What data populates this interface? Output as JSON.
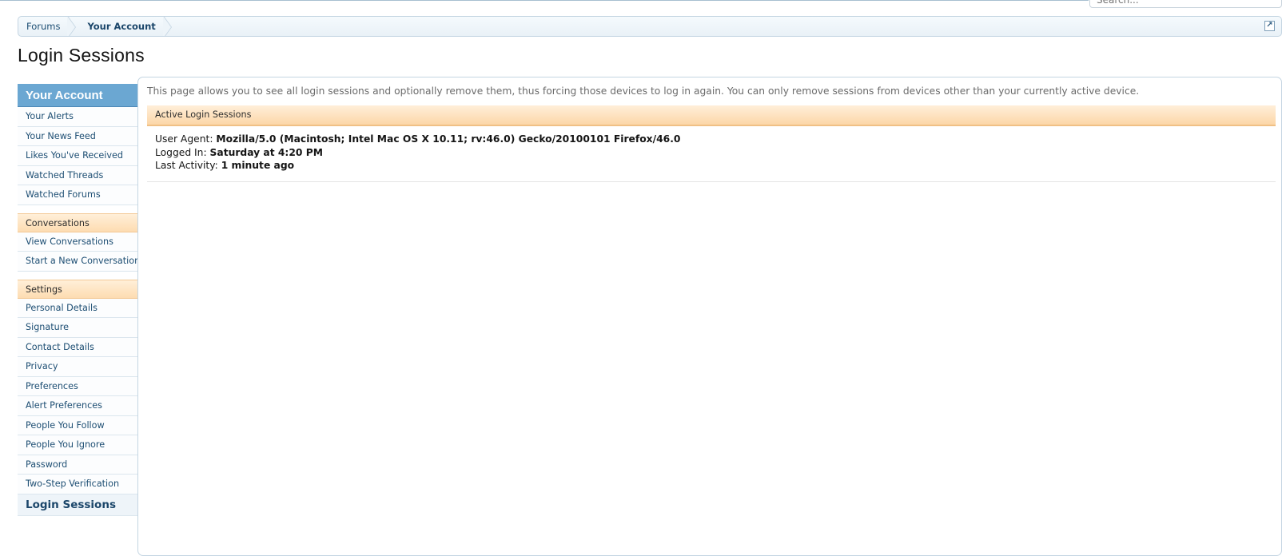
{
  "search": {
    "placeholder": "Search..."
  },
  "breadcrumb": {
    "items": [
      {
        "label": "Forums"
      },
      {
        "label": "Your Account"
      }
    ]
  },
  "page_title": "Login Sessions",
  "sidebar": {
    "header": "Your Account",
    "account_items": [
      {
        "label": "Your Alerts"
      },
      {
        "label": "Your News Feed"
      },
      {
        "label": "Likes You've Received"
      },
      {
        "label": "Watched Threads"
      },
      {
        "label": "Watched Forums"
      }
    ],
    "conversations_header": "Conversations",
    "conversation_items": [
      {
        "label": "View Conversations"
      },
      {
        "label": "Start a New Conversation"
      }
    ],
    "settings_header": "Settings",
    "settings_items": [
      {
        "label": "Personal Details"
      },
      {
        "label": "Signature"
      },
      {
        "label": "Contact Details"
      },
      {
        "label": "Privacy"
      },
      {
        "label": "Preferences"
      },
      {
        "label": "Alert Preferences"
      },
      {
        "label": "People You Follow"
      },
      {
        "label": "People You Ignore"
      },
      {
        "label": "Password"
      },
      {
        "label": "Two-Step Verification"
      },
      {
        "label": "Login Sessions"
      }
    ]
  },
  "main": {
    "intro": "This page allows you to see all login sessions and optionally remove them, thus forcing those devices to log in again. You can only remove sessions from devices other than your currently active device.",
    "sessions_header": "Active Login Sessions",
    "session": {
      "user_agent_label": "User Agent:",
      "user_agent_value": "Mozilla/5.0 (Macintosh; Intel Mac OS X 10.11; rv:46.0) Gecko/20100101 Firefox/46.0",
      "logged_in_label": "Logged In:",
      "logged_in_value": "Saturday at 4:20 PM",
      "last_activity_label": "Last Activity:",
      "last_activity_value": "1 minute ago"
    }
  }
}
